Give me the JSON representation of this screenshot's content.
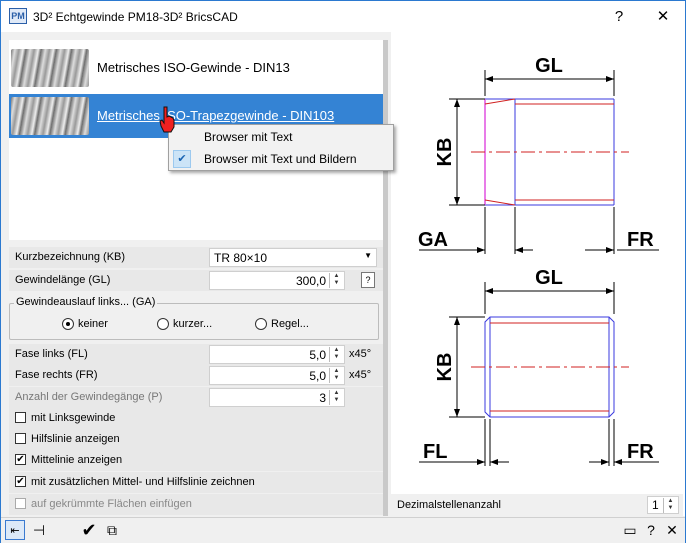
{
  "window": {
    "title": "3D² Echtgewinde  PM18-3D²  BricsCAD",
    "icon_text": "PM",
    "help_btn": "?",
    "close_btn": "✕"
  },
  "thread_list": {
    "items": [
      {
        "label": "Metrisches ISO-Gewinde - DIN13",
        "selected": false
      },
      {
        "label": "Metrisches ISO-Trapezgewinde - DIN103",
        "selected": true
      }
    ]
  },
  "context_menu": {
    "items": [
      {
        "label": "Browser mit Text",
        "checked": false
      },
      {
        "label": "Browser mit Text und Bildern",
        "checked": true
      }
    ]
  },
  "params": {
    "kurz_label": "Kurzbezeichnung  (KB)",
    "kurz_value": "TR 80×10",
    "gl_label": "Gewindelänge  (GL)",
    "gl_value": "300,0",
    "gl_help": "?",
    "auslauf_group": "Gewindeauslauf links...  (GA)",
    "radio_keiner": "keiner",
    "radio_kurzer": "kurzer...",
    "radio_regel": "Regel...",
    "fl_label": "Fase links  (FL)",
    "fl_value": "5,0",
    "fl_unit": "x45°",
    "fr_label": "Fase rechts  (FR)",
    "fr_value": "5,0",
    "fr_unit": "x45°",
    "gaenge_label": "Anzahl der Gewindegänge (P)",
    "gaenge_value": "3"
  },
  "options": [
    {
      "label": "mit Linksgewinde",
      "checked": false,
      "enabled": true
    },
    {
      "label": "Hilfslinie anzeigen",
      "checked": false,
      "enabled": true
    },
    {
      "label": "Mittelinie anzeigen",
      "checked": true,
      "enabled": true
    },
    {
      "label": "mit zusätzlichen Mittel- und Hilfslinie zeichnen",
      "checked": true,
      "enabled": true
    },
    {
      "label": "auf gekrümmte Flächen einfügen",
      "checked": false,
      "enabled": false
    }
  ],
  "preview": {
    "top": {
      "gl": "GL",
      "kb": "KB",
      "ga": "GA",
      "fr": "FR"
    },
    "bottom": {
      "gl": "GL",
      "kb": "KB",
      "fl": "FL",
      "fr": "FR"
    }
  },
  "decimal": {
    "label": "Dezimalstellenanzahl",
    "value": "1"
  },
  "bottom_bar": {
    "ok_symbol": "✔",
    "help": "?",
    "close": "✕"
  }
}
